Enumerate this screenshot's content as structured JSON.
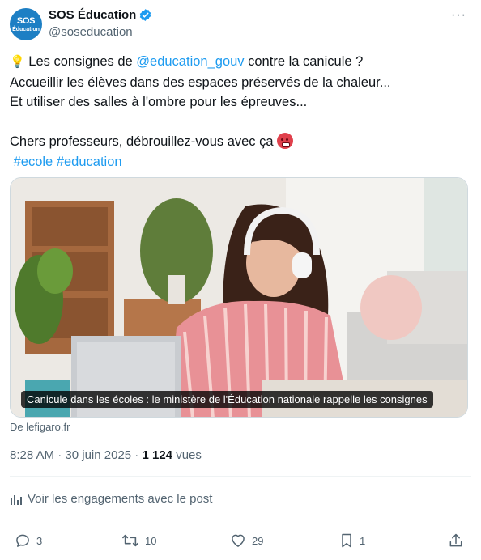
{
  "author": {
    "avatar_line1": "SOS",
    "avatar_line2": "Éducation",
    "name": "SOS Éducation",
    "handle": "@soseducation"
  },
  "more_label": "···",
  "tweet": {
    "line1_prefix": "💡",
    "line1_before": " Les consignes de ",
    "line1_mention": "@education_gouv",
    "line1_after": " contre la canicule ?",
    "line2": "Accueillir les élèves dans des espaces préservés de la chaleur...",
    "line3": "Et utiliser des salles à l'ombre pour les épreuves...",
    "line4": "Chers professeurs, débrouillez-vous avec ça",
    "hashtag1": "#ecole",
    "hashtag2": "#education"
  },
  "card": {
    "caption": "Canicule dans les écoles : le ministère de l'Éducation nationale rappelle les consignes",
    "source": "De lefigaro.fr"
  },
  "meta": {
    "time": "8:28 AM",
    "separator": " · ",
    "date": "30 juin 2025",
    "separator2": " · ",
    "views": "1 124",
    "views_label": " vues"
  },
  "engagements_label": "Voir les engagements avec le post",
  "actions": {
    "replies": "3",
    "reposts": "10",
    "likes": "29",
    "bookmarks": "1"
  },
  "colors": {
    "link": "#1d9bf0",
    "secondary_text": "#536471",
    "verified": "#1d9bf0"
  }
}
